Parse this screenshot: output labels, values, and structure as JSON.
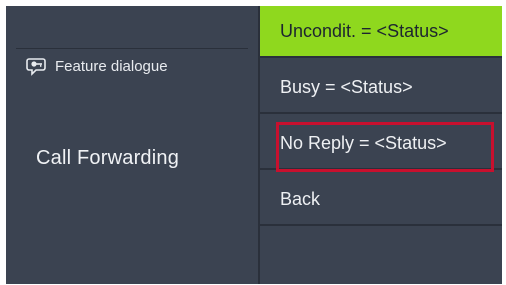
{
  "header": {
    "title": "Feature dialogue",
    "icon": "key-speech-bubble-icon"
  },
  "page": {
    "title": "Call Forwarding"
  },
  "menu": {
    "items": [
      {
        "label": "Uncondit. = <Status>",
        "selected": true
      },
      {
        "label": "Busy = <Status>",
        "selected": false
      },
      {
        "label": "No Reply = <Status>",
        "selected": false,
        "highlighted": true
      },
      {
        "label": "Back",
        "selected": false
      },
      {
        "label": "",
        "selected": false
      }
    ]
  },
  "colors": {
    "background": "#3b4351",
    "selected": "#8fd81e",
    "highlight": "#c8102e",
    "divider": "#2a303b"
  }
}
